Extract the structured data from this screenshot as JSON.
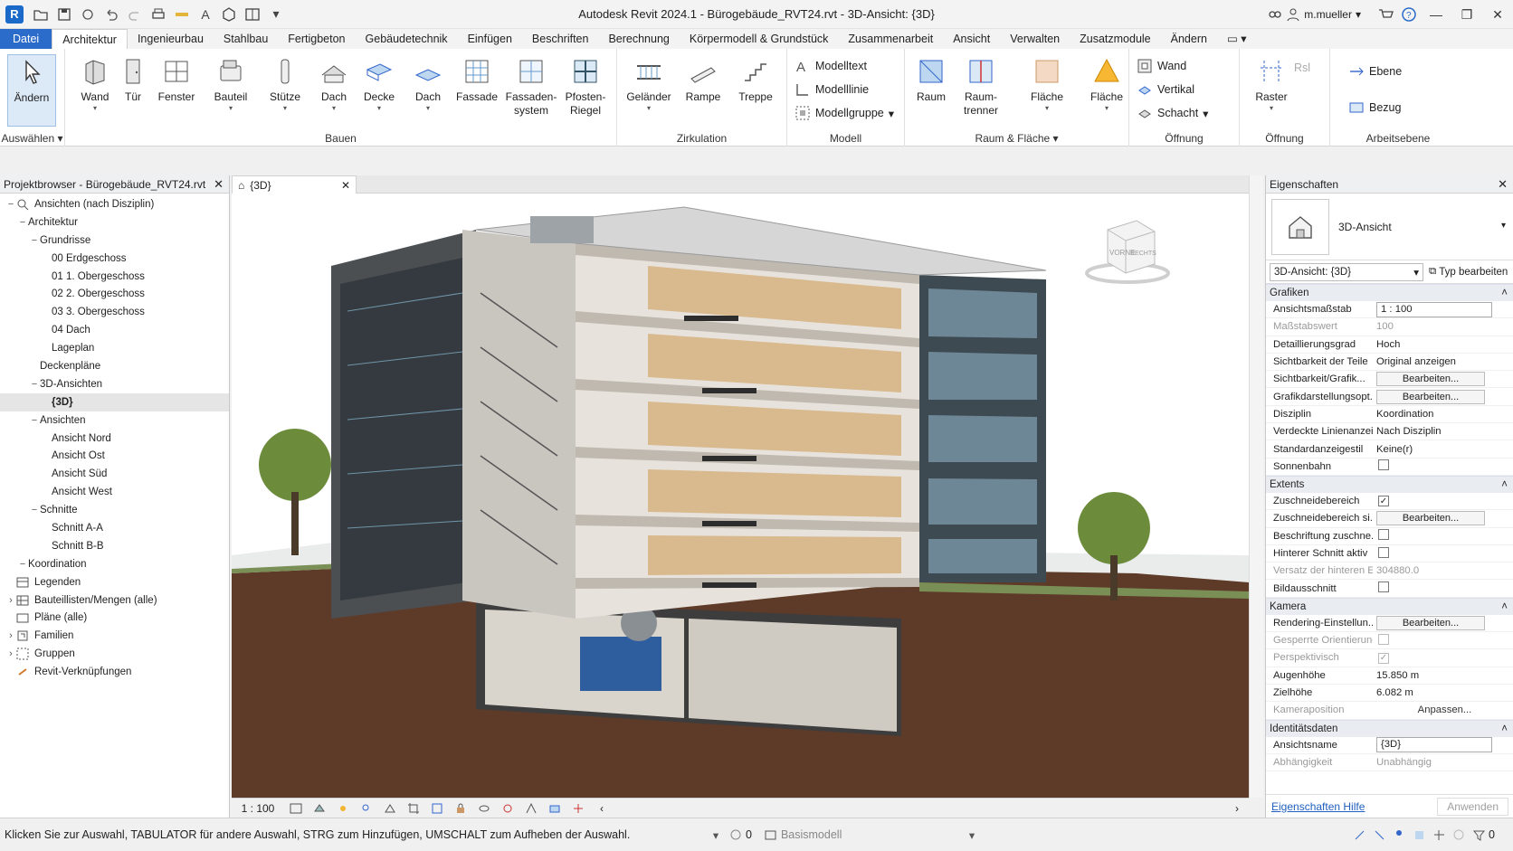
{
  "titlebar": {
    "app_letter": "R",
    "title": "Autodesk Revit 2024.1 - Bürogebäude_RVT24.rvt - 3D-Ansicht: {3D}",
    "user": "m.mueller"
  },
  "tabs": [
    "Datei",
    "Architektur",
    "Ingenieurbau",
    "Stahlbau",
    "Fertigbeton",
    "Gebäudetechnik",
    "Einfügen",
    "Beschriften",
    "Berechnung",
    "Körpermodell & Grundstück",
    "Zusammenarbeit",
    "Ansicht",
    "Verwalten",
    "Zusatzmodule",
    "Ändern"
  ],
  "ribbon": {
    "modify_label": "Ändern",
    "select_label": "Auswählen",
    "build": {
      "label": "Bauen",
      "buttons": [
        "Wand",
        "Tür",
        "Fenster",
        "Bauteil",
        "Stütze",
        "Dach",
        "Decke",
        "Dach",
        "Fassade",
        "Fassaden-\nsystem",
        "Pfosten-\nRiegel"
      ]
    },
    "circulation": {
      "label": "Zirkulation",
      "buttons": [
        "Geländer",
        "Rampe",
        "Treppe"
      ]
    },
    "model": {
      "label": "Modell",
      "items": [
        "Modelltext",
        "Modelllinie",
        "Modellgruppe"
      ]
    },
    "room": {
      "label": "Raum & Fläche",
      "buttons": [
        "Raum",
        "Raum-\ntrenner",
        "Fläche",
        "Fläche"
      ]
    },
    "opening": {
      "label": "Öffnung",
      "items": [
        "Wand",
        "Vertikal",
        "Schacht"
      ]
    },
    "datum": {
      "label": "Öffnung",
      "buttons": [
        "Ebene",
        "Bezug"
      ],
      "small": [
        "Raster",
        "Rsl"
      ]
    },
    "workplane": {
      "label": "Arbeitsebene",
      "items": [
        "Ebene",
        "Bezug"
      ]
    }
  },
  "browser": {
    "title": "Projektbrowser - Bürogebäude_RVT24.rvt",
    "nodes": [
      {
        "label": "Ansichten (nach Disziplin)",
        "level": 0,
        "tog": "−",
        "icon": "views"
      },
      {
        "label": "Architektur",
        "level": 1,
        "tog": "−",
        "icon": ""
      },
      {
        "label": "Grundrisse",
        "level": 2,
        "tog": "−",
        "icon": ""
      },
      {
        "label": "00 Erdgeschoss",
        "level": 3,
        "tog": "",
        "icon": ""
      },
      {
        "label": "01 1. Obergeschoss",
        "level": 3,
        "tog": "",
        "icon": ""
      },
      {
        "label": "02 2. Obergeschoss",
        "level": 3,
        "tog": "",
        "icon": ""
      },
      {
        "label": "03 3. Obergeschoss",
        "level": 3,
        "tog": "",
        "icon": ""
      },
      {
        "label": "04 Dach",
        "level": 3,
        "tog": "",
        "icon": ""
      },
      {
        "label": "Lageplan",
        "level": 3,
        "tog": "",
        "icon": ""
      },
      {
        "label": "Deckenpläne",
        "level": 2,
        "tog": "",
        "icon": ""
      },
      {
        "label": "3D-Ansichten",
        "level": 2,
        "tog": "−",
        "icon": ""
      },
      {
        "label": "{3D}",
        "level": 3,
        "tog": "",
        "icon": "",
        "selected": true
      },
      {
        "label": "Ansichten",
        "level": 2,
        "tog": "−",
        "icon": ""
      },
      {
        "label": "Ansicht Nord",
        "level": 3,
        "tog": "",
        "icon": ""
      },
      {
        "label": "Ansicht Ost",
        "level": 3,
        "tog": "",
        "icon": ""
      },
      {
        "label": "Ansicht Süd",
        "level": 3,
        "tog": "",
        "icon": ""
      },
      {
        "label": "Ansicht West",
        "level": 3,
        "tog": "",
        "icon": ""
      },
      {
        "label": "Schnitte",
        "level": 2,
        "tog": "−",
        "icon": ""
      },
      {
        "label": "Schnitt A-A",
        "level": 3,
        "tog": "",
        "icon": ""
      },
      {
        "label": "Schnitt B-B",
        "level": 3,
        "tog": "",
        "icon": ""
      },
      {
        "label": "Koordination",
        "level": 1,
        "tog": "−",
        "icon": ""
      },
      {
        "label": "Legenden",
        "level": 0,
        "tog": "",
        "icon": "legend"
      },
      {
        "label": "Bauteillisten/Mengen (alle)",
        "level": 0,
        "tog": "›",
        "icon": "schedule"
      },
      {
        "label": "Pläne (alle)",
        "level": 0,
        "tog": "",
        "icon": "sheet"
      },
      {
        "label": "Familien",
        "level": 0,
        "tog": "›",
        "icon": "family"
      },
      {
        "label": "Gruppen",
        "level": 0,
        "tog": "›",
        "icon": "group"
      },
      {
        "label": "Revit-Verknüpfungen",
        "level": 0,
        "tog": "",
        "icon": "link"
      }
    ]
  },
  "viewport": {
    "tab_label": "{3D}",
    "scale": "1 : 100",
    "viewcube_front": "VORNE",
    "viewcube_right": "RECHTS"
  },
  "properties": {
    "title": "Eigenschaften",
    "type_name": "3D-Ansicht",
    "view_select": "3D-Ansicht: {3D}",
    "edit_type": "Typ bearbeiten",
    "groups": [
      {
        "name": "Grafiken",
        "rows": [
          {
            "n": "Ansichtsmaßstab",
            "v": "1 : 100",
            "kind": "input"
          },
          {
            "n": "Maßstabswert",
            "v": "100",
            "kind": "text",
            "dim": true
          },
          {
            "n": "Detaillierungsgrad",
            "v": "Hoch",
            "kind": "text"
          },
          {
            "n": "Sichtbarkeit der Teile",
            "v": "Original anzeigen",
            "kind": "text"
          },
          {
            "n": "Sichtbarkeit/Grafik...",
            "v": "Bearbeiten...",
            "kind": "button"
          },
          {
            "n": "Grafikdarstellungsopt...",
            "v": "Bearbeiten...",
            "kind": "button"
          },
          {
            "n": "Disziplin",
            "v": "Koordination",
            "kind": "text"
          },
          {
            "n": "Verdeckte Linienanzeig",
            "v": "Nach Disziplin",
            "kind": "text"
          },
          {
            "n": "Standardanzeigestil",
            "v": "Keine(r)",
            "kind": "text"
          },
          {
            "n": "Sonnenbahn",
            "v": "",
            "kind": "check",
            "checked": false
          }
        ]
      },
      {
        "name": "Extents",
        "rows": [
          {
            "n": "Zuschneidebereich",
            "v": "",
            "kind": "check",
            "checked": true
          },
          {
            "n": "Zuschneidebereich si...",
            "v": "Bearbeiten...",
            "kind": "button"
          },
          {
            "n": "Beschriftung zuschne...",
            "v": "",
            "kind": "check",
            "checked": false
          },
          {
            "n": "Hinterer Schnitt aktiv",
            "v": "",
            "kind": "check",
            "checked": false
          },
          {
            "n": "Versatz der hinteren E...",
            "v": "304880.0",
            "kind": "text",
            "dim": true
          },
          {
            "n": "Bildausschnitt",
            "v": "",
            "kind": "check",
            "checked": false
          }
        ]
      },
      {
        "name": "Kamera",
        "rows": [
          {
            "n": "Rendering-Einstellun...",
            "v": "Bearbeiten...",
            "kind": "button"
          },
          {
            "n": "Gesperrte Orientierung",
            "v": "",
            "kind": "check",
            "checked": false,
            "dim": true
          },
          {
            "n": "Perspektivisch",
            "v": "",
            "kind": "check",
            "checked": true,
            "dim": true
          },
          {
            "n": "Augenhöhe",
            "v": "15.850 m",
            "kind": "text"
          },
          {
            "n": "Zielhöhe",
            "v": "6.082 m",
            "kind": "text"
          },
          {
            "n": "Kameraposition",
            "v": "Anpassen...",
            "kind": "link",
            "dim": true
          }
        ]
      },
      {
        "name": "Identitätsdaten",
        "rows": [
          {
            "n": "Ansichtsname",
            "v": "{3D}",
            "kind": "input"
          },
          {
            "n": "Abhängigkeit",
            "v": "Unabhängig",
            "kind": "text",
            "dim": true
          }
        ]
      }
    ],
    "help_link": "Eigenschaften Hilfe",
    "apply": "Anwenden"
  },
  "statusbar": {
    "message": "Klicken Sie zur Auswahl, TABULATOR für andere Auswahl, STRG zum Hinzufügen, UMSCHALT zum Aufheben der Auswahl.",
    "count": "0",
    "model": "Basismodell",
    "filter_count": "0"
  },
  "colors": {
    "accent": "#2b6bc9",
    "selection": "#dce9f7",
    "soil": "#5b3a28",
    "sky": "#ffffff"
  }
}
